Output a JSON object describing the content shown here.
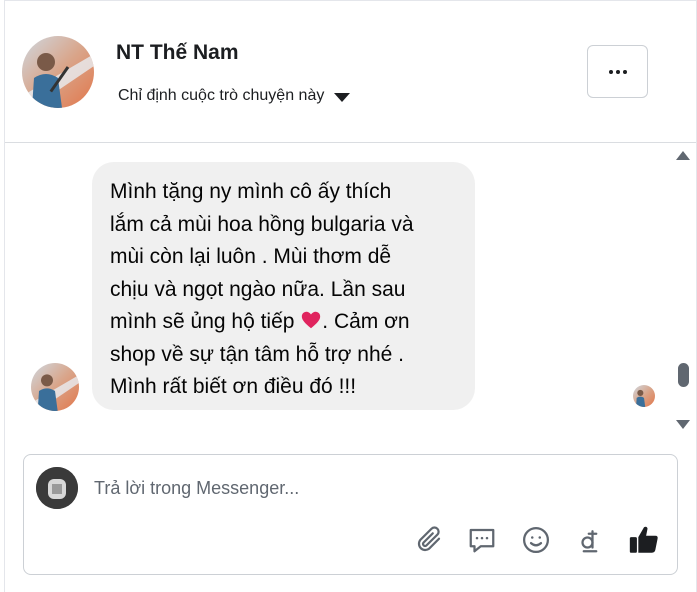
{
  "header": {
    "contact_name": "NT Thế Nam",
    "assign_label": "Chỉ định cuộc trò chuyện này",
    "more_label": "..."
  },
  "message": {
    "text": "Mình tặng ny mình cô ấy thích\nlắm cả mùi hoa hồng bulgaria và\nmùi còn lại luôn . Mùi thơm dễ\nchịu và ngọt ngào nữa. Lần sau\nmình sẽ ủng hộ tiếp ",
    "text_after_heart": ". Cảm ơn\nshop về sự tận tâm hỗ trợ nhé .\nMình rất biết ơn điều đó !!!",
    "emoji": "heart-emoji"
  },
  "composer": {
    "placeholder": "Trả lời trong Messenger...",
    "tools": [
      "attachment-icon",
      "saved-reply-icon",
      "emoji-icon",
      "payment-dong-icon",
      "thumbs-up-icon"
    ]
  },
  "colors": {
    "bubble": "#f0f0f0",
    "icon": "#606770",
    "heart": "#e0245e"
  }
}
